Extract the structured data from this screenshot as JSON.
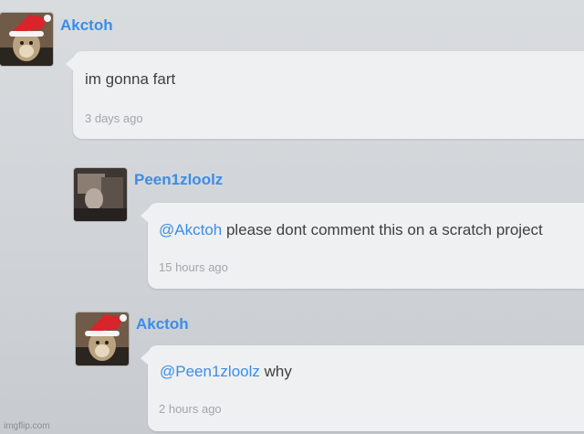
{
  "comments": [
    {
      "author": "Akctoh",
      "mention": "",
      "text": "im gonna fart",
      "time": "3 days ago",
      "avatar": "cat-santa-hat"
    },
    {
      "author": "Peen1zloolz",
      "mention": "@Akctoh",
      "text": "please dont comment this on a scratch project",
      "time": "15 hours ago",
      "avatar": "dark-photo"
    },
    {
      "author": "Akctoh",
      "mention": "@Peen1zloolz",
      "text": "why",
      "time": "2 hours ago",
      "avatar": "cat-santa-hat"
    }
  ],
  "watermark": "imgflip.com",
  "colors": {
    "username": "#3b8de8",
    "bubble": "#eef0f2",
    "timestamp": "#a3a7ab"
  }
}
